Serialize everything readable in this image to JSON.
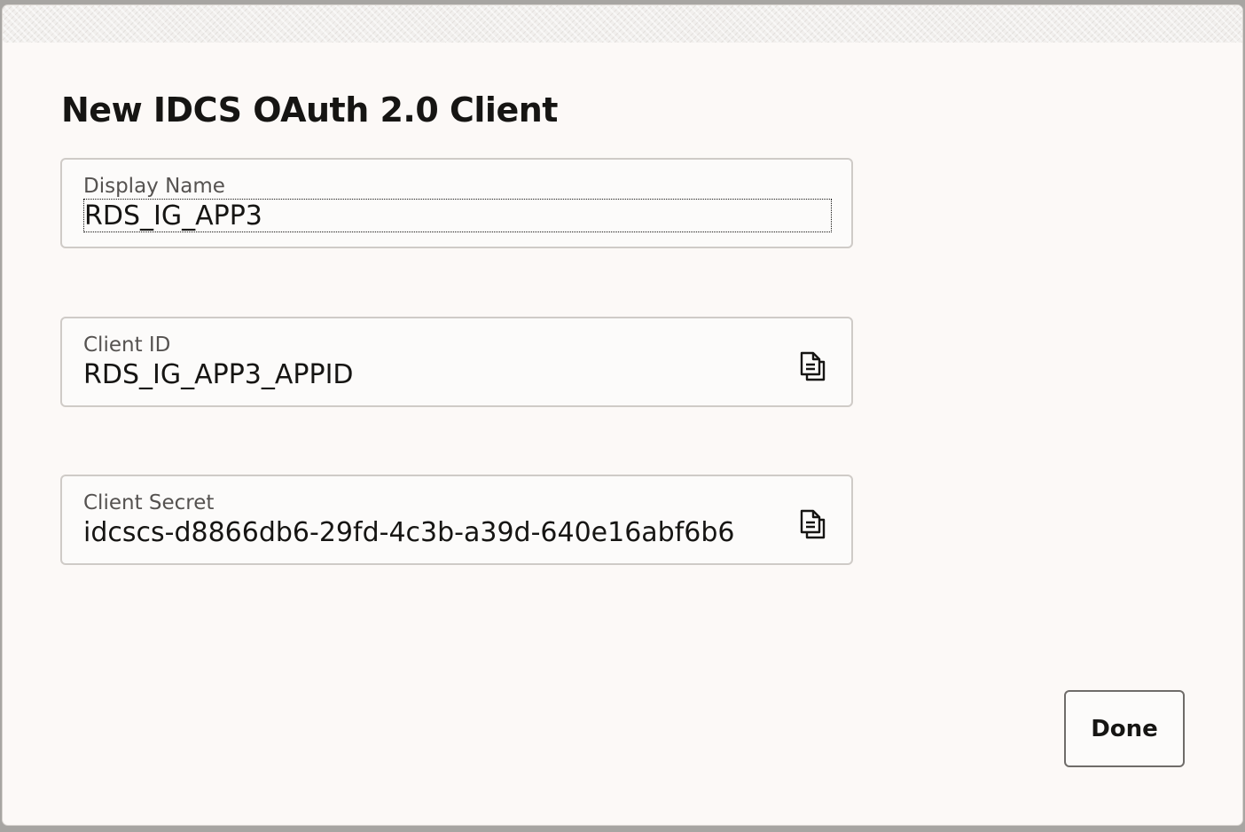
{
  "dialog": {
    "title": "New IDCS OAuth 2.0 Client",
    "fields": {
      "display_name": {
        "label": "Display Name",
        "value": "RDS_IG_APP3"
      },
      "client_id": {
        "label": "Client ID",
        "value": "RDS_IG_APP3_APPID",
        "copy_icon": "copy-icon"
      },
      "client_secret": {
        "label": "Client Secret",
        "value": "idcscs-d8866db6-29fd-4c3b-a39d-640e16abf6b6",
        "copy_icon": "copy-icon"
      }
    },
    "done_label": "Done"
  },
  "colors": {
    "dialog_background": "#fcf9f7",
    "text_primary": "#161513",
    "text_label": "#555250",
    "field_border": "#cfcbc7",
    "button_border": "#6f6c69"
  }
}
